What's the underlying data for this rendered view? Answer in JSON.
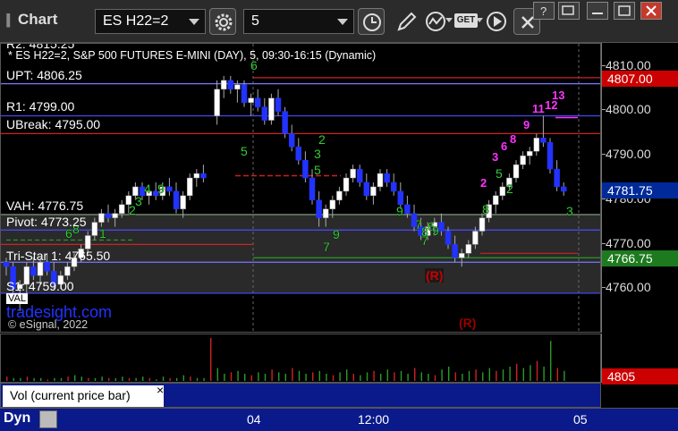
{
  "toolbar": {
    "title": "Chart",
    "symbol": "ES H22=2",
    "interval": "5",
    "get_label": "GET"
  },
  "chart": {
    "header": "* ES H22=2, S&P 500 FUTURES E-MINI (DAY), 5, 09:30-16:15 (Dynamic)",
    "clipped_top_label": "R2: 4815.25",
    "levels": {
      "upt": "UPT: 4806.25",
      "r1": "R1: 4799.00",
      "ubreak": "UBreak: 4795.00",
      "vah": "VAH: 4776.75",
      "pivot": "Pivot: 4773.25",
      "tristar": "Tri-Star 1: 4765.50",
      "s1": "S1: 4759.00",
      "val": "VAL"
    },
    "watermark": "tradesight.com",
    "copyright": "© eSignal, 2022",
    "r_marker_1": "(R)",
    "r_marker_2": "(R)",
    "counts": {
      "magenta": [
        "2",
        "3",
        "6",
        "8",
        "9",
        "11",
        "12",
        "13"
      ],
      "green": [
        "6",
        "5",
        "4",
        "3",
        "2",
        "1",
        "6",
        "9",
        "8",
        "7",
        "9",
        "5",
        "3",
        "2",
        "9",
        "7",
        "8",
        "6",
        "7",
        "9",
        "5",
        "2",
        "8",
        "3"
      ]
    },
    "candles": [
      {
        "t": 0,
        "o": 4766,
        "h": 4767,
        "l": 4763,
        "c": 4765
      },
      {
        "t": 1,
        "o": 4765,
        "h": 4766,
        "l": 4758,
        "c": 4760
      },
      {
        "t": 2,
        "o": 4760,
        "h": 4762,
        "l": 4755,
        "c": 4761
      },
      {
        "t": 3,
        "o": 4761,
        "h": 4766,
        "l": 4759,
        "c": 4765
      },
      {
        "t": 4,
        "o": 4765,
        "h": 4767,
        "l": 4762,
        "c": 4763
      },
      {
        "t": 5,
        "o": 4763,
        "h": 4767,
        "l": 4761,
        "c": 4766
      },
      {
        "t": 6,
        "o": 4766,
        "h": 4768,
        "l": 4763,
        "c": 4764
      },
      {
        "t": 7,
        "o": 4764,
        "h": 4766,
        "l": 4760,
        "c": 4761
      },
      {
        "t": 8,
        "o": 4761,
        "h": 4764,
        "l": 4760,
        "c": 4763
      },
      {
        "t": 9,
        "o": 4763,
        "h": 4766,
        "l": 4762,
        "c": 4765
      },
      {
        "t": 10,
        "o": 4765,
        "h": 4768,
        "l": 4764,
        "c": 4767
      },
      {
        "t": 11,
        "o": 4767,
        "h": 4770,
        "l": 4766,
        "c": 4769
      },
      {
        "t": 12,
        "o": 4769,
        "h": 4773,
        "l": 4768,
        "c": 4772
      },
      {
        "t": 13,
        "o": 4772,
        "h": 4776,
        "l": 4771,
        "c": 4775
      },
      {
        "t": 14,
        "o": 4775,
        "h": 4778,
        "l": 4774,
        "c": 4777
      },
      {
        "t": 15,
        "o": 4777,
        "h": 4779,
        "l": 4775,
        "c": 4776
      },
      {
        "t": 16,
        "o": 4776,
        "h": 4778,
        "l": 4774,
        "c": 4777
      },
      {
        "t": 17,
        "o": 4777,
        "h": 4780,
        "l": 4776,
        "c": 4779
      },
      {
        "t": 18,
        "o": 4779,
        "h": 4782,
        "l": 4777,
        "c": 4781
      },
      {
        "t": 19,
        "o": 4781,
        "h": 4784,
        "l": 4780,
        "c": 4783
      },
      {
        "t": 20,
        "o": 4783,
        "h": 4784,
        "l": 4780,
        "c": 4781
      },
      {
        "t": 21,
        "o": 4781,
        "h": 4783,
        "l": 4779,
        "c": 4782
      },
      {
        "t": 22,
        "o": 4782,
        "h": 4784,
        "l": 4780,
        "c": 4781
      },
      {
        "t": 23,
        "o": 4781,
        "h": 4784,
        "l": 4780,
        "c": 4783
      },
      {
        "t": 24,
        "o": 4783,
        "h": 4785,
        "l": 4781,
        "c": 4782
      },
      {
        "t": 25,
        "o": 4782,
        "h": 4784,
        "l": 4777,
        "c": 4778
      },
      {
        "t": 26,
        "o": 4778,
        "h": 4782,
        "l": 4776,
        "c": 4781
      },
      {
        "t": 27,
        "o": 4781,
        "h": 4786,
        "l": 4780,
        "c": 4785
      },
      {
        "t": 28,
        "o": 4785,
        "h": 4787,
        "l": 4783,
        "c": 4786
      },
      {
        "t": 29,
        "o": 4786,
        "h": 4788,
        "l": 4784,
        "c": 4785
      },
      {
        "t": 31,
        "o": 4799,
        "h": 4807,
        "l": 4797,
        "c": 4805
      },
      {
        "t": 32,
        "o": 4805,
        "h": 4808,
        "l": 4803,
        "c": 4807
      },
      {
        "t": 33,
        "o": 4807,
        "h": 4808,
        "l": 4804,
        "c": 4805
      },
      {
        "t": 34,
        "o": 4805,
        "h": 4807,
        "l": 4802,
        "c": 4806
      },
      {
        "t": 35,
        "o": 4806,
        "h": 4807,
        "l": 4801,
        "c": 4802
      },
      {
        "t": 36,
        "o": 4802,
        "h": 4804,
        "l": 4799,
        "c": 4803
      },
      {
        "t": 37,
        "o": 4803,
        "h": 4805,
        "l": 4800,
        "c": 4801
      },
      {
        "t": 38,
        "o": 4801,
        "h": 4803,
        "l": 4797,
        "c": 4798
      },
      {
        "t": 39,
        "o": 4798,
        "h": 4804,
        "l": 4797,
        "c": 4803
      },
      {
        "t": 40,
        "o": 4803,
        "h": 4805,
        "l": 4799,
        "c": 4800
      },
      {
        "t": 41,
        "o": 4800,
        "h": 4801,
        "l": 4794,
        "c": 4795
      },
      {
        "t": 42,
        "o": 4795,
        "h": 4797,
        "l": 4791,
        "c": 4792
      },
      {
        "t": 43,
        "o": 4792,
        "h": 4794,
        "l": 4788,
        "c": 4789
      },
      {
        "t": 44,
        "o": 4789,
        "h": 4791,
        "l": 4784,
        "c": 4785
      },
      {
        "t": 45,
        "o": 4785,
        "h": 4787,
        "l": 4779,
        "c": 4780
      },
      {
        "t": 46,
        "o": 4780,
        "h": 4782,
        "l": 4774,
        "c": 4776
      },
      {
        "t": 47,
        "o": 4776,
        "h": 4779,
        "l": 4774,
        "c": 4778
      },
      {
        "t": 48,
        "o": 4778,
        "h": 4781,
        "l": 4776,
        "c": 4780
      },
      {
        "t": 49,
        "o": 4780,
        "h": 4783,
        "l": 4779,
        "c": 4782
      },
      {
        "t": 50,
        "o": 4782,
        "h": 4786,
        "l": 4781,
        "c": 4785
      },
      {
        "t": 51,
        "o": 4785,
        "h": 4788,
        "l": 4784,
        "c": 4787
      },
      {
        "t": 52,
        "o": 4787,
        "h": 4788,
        "l": 4783,
        "c": 4784
      },
      {
        "t": 53,
        "o": 4784,
        "h": 4786,
        "l": 4780,
        "c": 4781
      },
      {
        "t": 54,
        "o": 4781,
        "h": 4784,
        "l": 4779,
        "c": 4783
      },
      {
        "t": 55,
        "o": 4783,
        "h": 4787,
        "l": 4782,
        "c": 4786
      },
      {
        "t": 56,
        "o": 4786,
        "h": 4787,
        "l": 4783,
        "c": 4784
      },
      {
        "t": 57,
        "o": 4784,
        "h": 4786,
        "l": 4781,
        "c": 4782
      },
      {
        "t": 58,
        "o": 4782,
        "h": 4784,
        "l": 4778,
        "c": 4779
      },
      {
        "t": 59,
        "o": 4779,
        "h": 4781,
        "l": 4776,
        "c": 4777
      },
      {
        "t": 60,
        "o": 4777,
        "h": 4779,
        "l": 4773,
        "c": 4774
      },
      {
        "t": 61,
        "o": 4774,
        "h": 4776,
        "l": 4771,
        "c": 4772
      },
      {
        "t": 62,
        "o": 4772,
        "h": 4775,
        "l": 4771,
        "c": 4774
      },
      {
        "t": 63,
        "o": 4774,
        "h": 4776,
        "l": 4772,
        "c": 4775
      },
      {
        "t": 64,
        "o": 4775,
        "h": 4777,
        "l": 4772,
        "c": 4773
      },
      {
        "t": 65,
        "o": 4773,
        "h": 4774,
        "l": 4769,
        "c": 4770
      },
      {
        "t": 66,
        "o": 4770,
        "h": 4772,
        "l": 4766,
        "c": 4767
      },
      {
        "t": 67,
        "o": 4767,
        "h": 4769,
        "l": 4765,
        "c": 4768
      },
      {
        "t": 68,
        "o": 4768,
        "h": 4771,
        "l": 4767,
        "c": 4770
      },
      {
        "t": 69,
        "o": 4770,
        "h": 4774,
        "l": 4769,
        "c": 4773
      },
      {
        "t": 70,
        "o": 4773,
        "h": 4777,
        "l": 4772,
        "c": 4776
      },
      {
        "t": 71,
        "o": 4776,
        "h": 4780,
        "l": 4775,
        "c": 4779
      },
      {
        "t": 72,
        "o": 4779,
        "h": 4782,
        "l": 4777,
        "c": 4781
      },
      {
        "t": 73,
        "o": 4781,
        "h": 4784,
        "l": 4780,
        "c": 4783
      },
      {
        "t": 74,
        "o": 4783,
        "h": 4786,
        "l": 4782,
        "c": 4785
      },
      {
        "t": 75,
        "o": 4785,
        "h": 4789,
        "l": 4784,
        "c": 4788
      },
      {
        "t": 76,
        "o": 4788,
        "h": 4791,
        "l": 4787,
        "c": 4790
      },
      {
        "t": 77,
        "o": 4790,
        "h": 4792,
        "l": 4788,
        "c": 4791
      },
      {
        "t": 78,
        "o": 4791,
        "h": 4795,
        "l": 4790,
        "c": 4794
      },
      {
        "t": 79,
        "o": 4794,
        "h": 4799,
        "l": 4792,
        "c": 4793
      },
      {
        "t": 80,
        "o": 4793,
        "h": 4794,
        "l": 4786,
        "c": 4787
      },
      {
        "t": 81,
        "o": 4787,
        "h": 4789,
        "l": 4782,
        "c": 4783
      },
      {
        "t": 82,
        "o": 4783,
        "h": 4784,
        "l": 4781,
        "c": 4782
      }
    ],
    "volumes": [
      3,
      2,
      2,
      3,
      2,
      2,
      1,
      2,
      2,
      3,
      4,
      3,
      2,
      2,
      3,
      2,
      2,
      3,
      2,
      2,
      3,
      2,
      1,
      3,
      2,
      2,
      4,
      3,
      2,
      2,
      30,
      9,
      5,
      6,
      7,
      5,
      4,
      6,
      5,
      8,
      6,
      5,
      9,
      7,
      5,
      6,
      7,
      5,
      4,
      6,
      8,
      5,
      4,
      6,
      7,
      5,
      8,
      6,
      7,
      5,
      9,
      6,
      5,
      4,
      8,
      10,
      6,
      5,
      7,
      8,
      6,
      9,
      7,
      8,
      10,
      12,
      9,
      11,
      14,
      10,
      28,
      9,
      7
    ]
  },
  "price_axis": {
    "ticks": [
      "4810.00",
      "4800.00",
      "4790.00",
      "4780.00",
      "4770.00",
      "4760.00"
    ],
    "badge_upper": "4807.00",
    "badge_last": "4781.75",
    "badge_lower": "4766.75",
    "vol_badge": "4805"
  },
  "volume_pane": {
    "label": "Vol (current price bar)",
    "close_glyph": "×"
  },
  "time_axis": {
    "labels": [
      "04",
      "12:00",
      "05"
    ],
    "dyn_label": "Dyn"
  }
}
